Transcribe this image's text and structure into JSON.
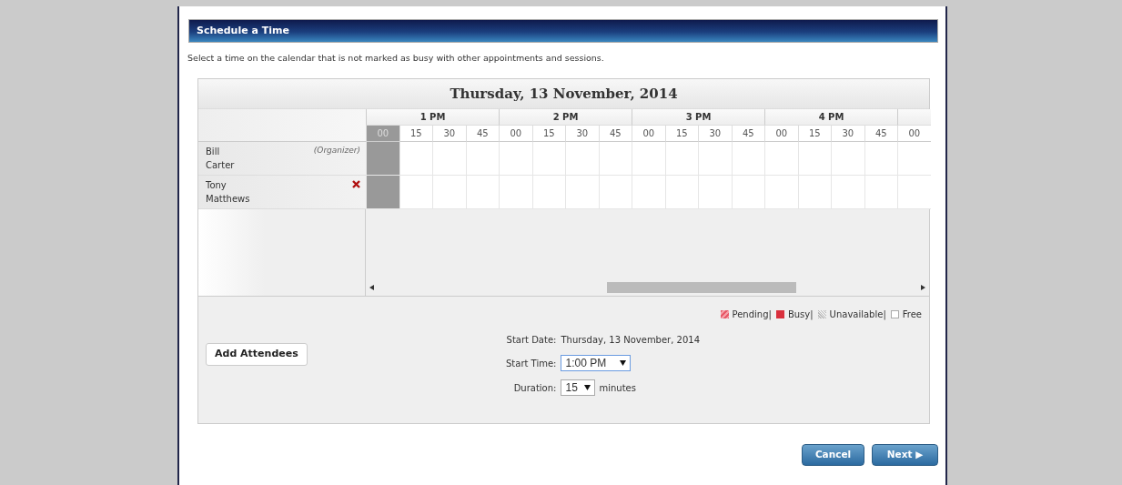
{
  "panel_title": "Schedule a Time",
  "instructions": "Select a time on the calendar that is not marked as busy with other appointments and sessions.",
  "calendar": {
    "date_title": "Thursday, 13 November, 2014",
    "hours": [
      {
        "label": "1 PM",
        "slots": [
          {
            "label": "00",
            "selected": true
          },
          {
            "label": "15",
            "selected": false
          },
          {
            "label": "30",
            "selected": false
          },
          {
            "label": "45",
            "selected": false
          }
        ]
      },
      {
        "label": "2 PM",
        "slots": [
          {
            "label": "00",
            "selected": false
          },
          {
            "label": "15",
            "selected": false
          },
          {
            "label": "30",
            "selected": false
          },
          {
            "label": "45",
            "selected": false
          }
        ]
      },
      {
        "label": "3 PM",
        "slots": [
          {
            "label": "00",
            "selected": false
          },
          {
            "label": "15",
            "selected": false
          },
          {
            "label": "30",
            "selected": false
          },
          {
            "label": "45",
            "selected": false
          }
        ]
      },
      {
        "label": "4 PM",
        "slots": [
          {
            "label": "00",
            "selected": false
          },
          {
            "label": "15",
            "selected": false
          },
          {
            "label": "30",
            "selected": false
          },
          {
            "label": "45",
            "selected": false
          }
        ]
      },
      {
        "slots": [
          {
            "label": "00",
            "selected": false
          }
        ]
      }
    ],
    "attendees": [
      {
        "first": "Bill",
        "last": "Carter",
        "kind": "organizer",
        "role": "(Organizer)"
      },
      {
        "first": "Tony",
        "last": "Matthews",
        "kind": "removable"
      }
    ]
  },
  "legend": [
    {
      "kind": "pending",
      "label": "Pending|"
    },
    {
      "kind": "busy",
      "label": "Busy|"
    },
    {
      "kind": "unavailable",
      "label": "Unavailable|"
    },
    {
      "kind": "free",
      "label": "Free"
    }
  ],
  "add_button": "Add Attendees",
  "start_date": {
    "label": "Start Date:",
    "value": "Thursday, 13 November, 2014"
  },
  "start_time": {
    "label": "Start Time:",
    "value": "1:00 PM"
  },
  "duration": {
    "label": "Duration:",
    "value": "15",
    "unit": "minutes"
  },
  "buttons": [
    {
      "label": "Cancel"
    },
    {
      "label": "Next ▶"
    }
  ]
}
